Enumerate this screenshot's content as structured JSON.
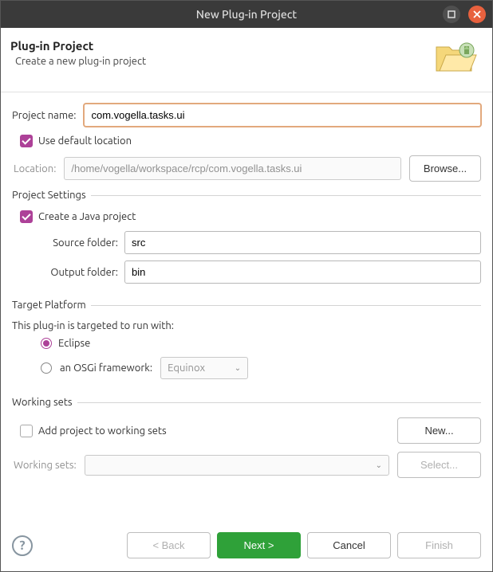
{
  "titlebar": {
    "title": "New Plug-in Project"
  },
  "header": {
    "title": "Plug-in Project",
    "subtitle": "Create a new plug-in project"
  },
  "project_name": {
    "label": "Project name:",
    "value": "com.vogella.tasks.ui"
  },
  "default_location": {
    "label": "Use default location",
    "checked": true
  },
  "location": {
    "label": "Location:",
    "value": "/home/vogella/workspace/rcp/com.vogella.tasks.ui",
    "browse": "Browse..."
  },
  "project_settings": {
    "legend": "Project Settings",
    "create_java": {
      "label": "Create a Java project",
      "checked": true
    },
    "source_folder": {
      "label": "Source folder:",
      "value": "src"
    },
    "output_folder": {
      "label": "Output folder:",
      "value": "bin"
    }
  },
  "target_platform": {
    "legend": "Target Platform",
    "intro": "This plug-in is targeted to run with:",
    "eclipse": {
      "label": "Eclipse",
      "selected": true
    },
    "osgi": {
      "label": "an OSGi framework:",
      "selected": false,
      "value": "Equinox"
    }
  },
  "working_sets": {
    "legend": "Working sets",
    "add": {
      "label": "Add project to working sets",
      "checked": false
    },
    "new": "New...",
    "label": "Working sets:",
    "select": "Select..."
  },
  "footer": {
    "back": "< Back",
    "next": "Next >",
    "cancel": "Cancel",
    "finish": "Finish"
  }
}
